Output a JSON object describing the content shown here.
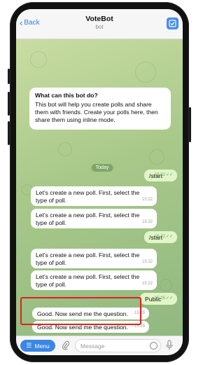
{
  "header": {
    "back_label": "Back",
    "title": "VoteBot",
    "subtitle": "bot"
  },
  "info_card": {
    "heading": "What can this bot do?",
    "body": "This bot will help you create polls and share them with friends. Create your polls here, then share them using inline mode."
  },
  "date_chip": "Today",
  "messages": [
    {
      "text": "/start",
      "time": "15:22",
      "outgoing": true
    },
    {
      "text": "Let's create a new poll. First, select the type of poll.",
      "time": "15:22",
      "outgoing": false
    },
    {
      "text": "Let's create a new poll. First, select the type of poll.",
      "time": "15:22",
      "outgoing": false
    },
    {
      "text": "/start",
      "time": "15:22",
      "outgoing": true
    },
    {
      "text": "Let's create a new poll. First, select the type of poll.",
      "time": "15:22",
      "outgoing": false
    },
    {
      "text": "Let's create a new poll. First, select the type of poll.",
      "time": "15:22",
      "outgoing": false
    },
    {
      "text": "Public",
      "time": "15:25",
      "outgoing": true
    },
    {
      "text": "Good. Now send me the question.",
      "time": "15:29",
      "outgoing": false
    },
    {
      "text": "Good. Now send me the question.",
      "time": "15:29",
      "outgoing": false
    }
  ],
  "input_bar": {
    "menu_label": "Menu",
    "placeholder": "Message"
  },
  "colors": {
    "accent": "#3a86e6",
    "outgoing_bubble": "#e1f6c8",
    "highlight": "#e02020"
  }
}
